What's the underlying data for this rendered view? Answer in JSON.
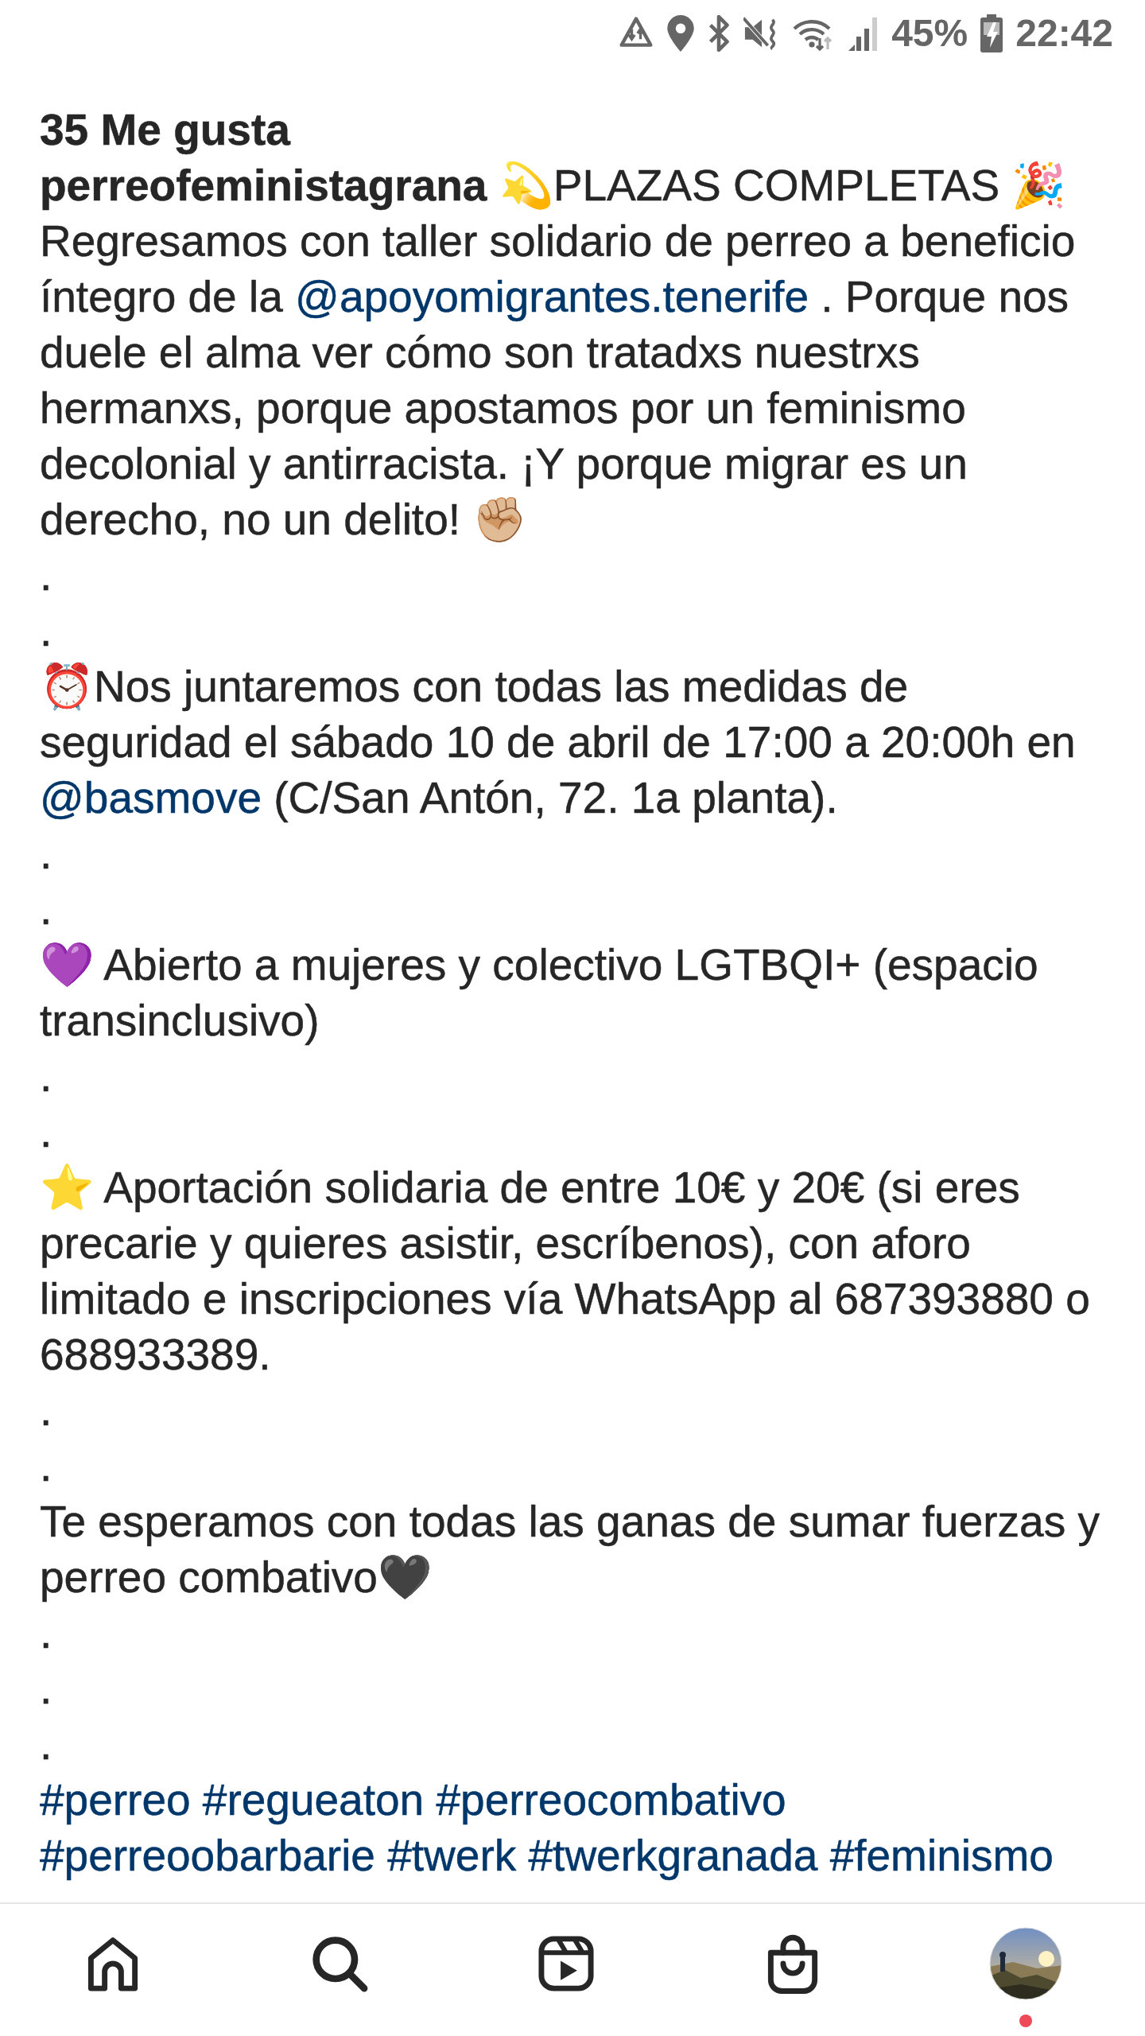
{
  "status_bar": {
    "battery": "45%",
    "time": "22:42"
  },
  "likes": "35 Me gusta",
  "caption": [
    {
      "parts": [
        {
          "kind": "username",
          "text": "perreofeministagrana"
        },
        {
          "kind": "plain",
          "text": " 💫PLAZAS COMPLETAS 🎉 Regresamos con taller solidario de perreo a beneficio íntegro de la "
        },
        {
          "kind": "mention",
          "text": "@apoyomigrantes.tenerife"
        },
        {
          "kind": "plain",
          "text": " . Porque nos duele el alma ver cómo son tratadxs nuestrxs hermanxs, porque apostamos por un feminismo decolonial y antirracista. ¡Y porque migrar es un derecho, no un delito! ✊🏼"
        }
      ]
    },
    {
      "parts": [
        {
          "kind": "plain",
          "text": "."
        }
      ]
    },
    {
      "parts": [
        {
          "kind": "plain",
          "text": "."
        }
      ]
    },
    {
      "parts": [
        {
          "kind": "plain",
          "text": "⏰Nos juntaremos con todas las medidas de seguridad el sábado 10 de abril de 17:00 a 20:00h en "
        },
        {
          "kind": "mention",
          "text": "@basmove"
        },
        {
          "kind": "plain",
          "text": " (C/San Antón, 72. 1a planta)."
        }
      ]
    },
    {
      "parts": [
        {
          "kind": "plain",
          "text": "."
        }
      ]
    },
    {
      "parts": [
        {
          "kind": "plain",
          "text": "."
        }
      ]
    },
    {
      "parts": [
        {
          "kind": "plain",
          "text": "💜 Abierto a mujeres y colectivo LGTBQI+ (espacio transinclusivo)"
        }
      ]
    },
    {
      "parts": [
        {
          "kind": "plain",
          "text": "."
        }
      ]
    },
    {
      "parts": [
        {
          "kind": "plain",
          "text": "."
        }
      ]
    },
    {
      "parts": [
        {
          "kind": "plain",
          "text": "⭐ Aportación solidaria de entre 10€ y 20€ (si eres precarie y quieres asistir, escríbenos), con aforo limitado e inscripciones vía WhatsApp al 687393880 o 688933389."
        }
      ]
    },
    {
      "parts": [
        {
          "kind": "plain",
          "text": "."
        }
      ]
    },
    {
      "parts": [
        {
          "kind": "plain",
          "text": "."
        }
      ]
    },
    {
      "parts": [
        {
          "kind": "plain",
          "text": "Te esperamos con todas las ganas de sumar fuerzas y perreo combativo🖤"
        }
      ]
    },
    {
      "parts": [
        {
          "kind": "plain",
          "text": "."
        }
      ]
    },
    {
      "parts": [
        {
          "kind": "plain",
          "text": "."
        }
      ]
    },
    {
      "parts": [
        {
          "kind": "plain",
          "text": "."
        }
      ]
    }
  ],
  "hashtags": [
    "#perreo",
    "#regueaton",
    "#perreocombativo",
    "#perreoobarbarie",
    "#twerk",
    "#twerkgranada",
    "#feminismo"
  ],
  "nav": [
    {
      "kind": "home"
    },
    {
      "kind": "search"
    },
    {
      "kind": "reels"
    },
    {
      "kind": "shop"
    },
    {
      "kind": "profile",
      "notification": true
    }
  ]
}
